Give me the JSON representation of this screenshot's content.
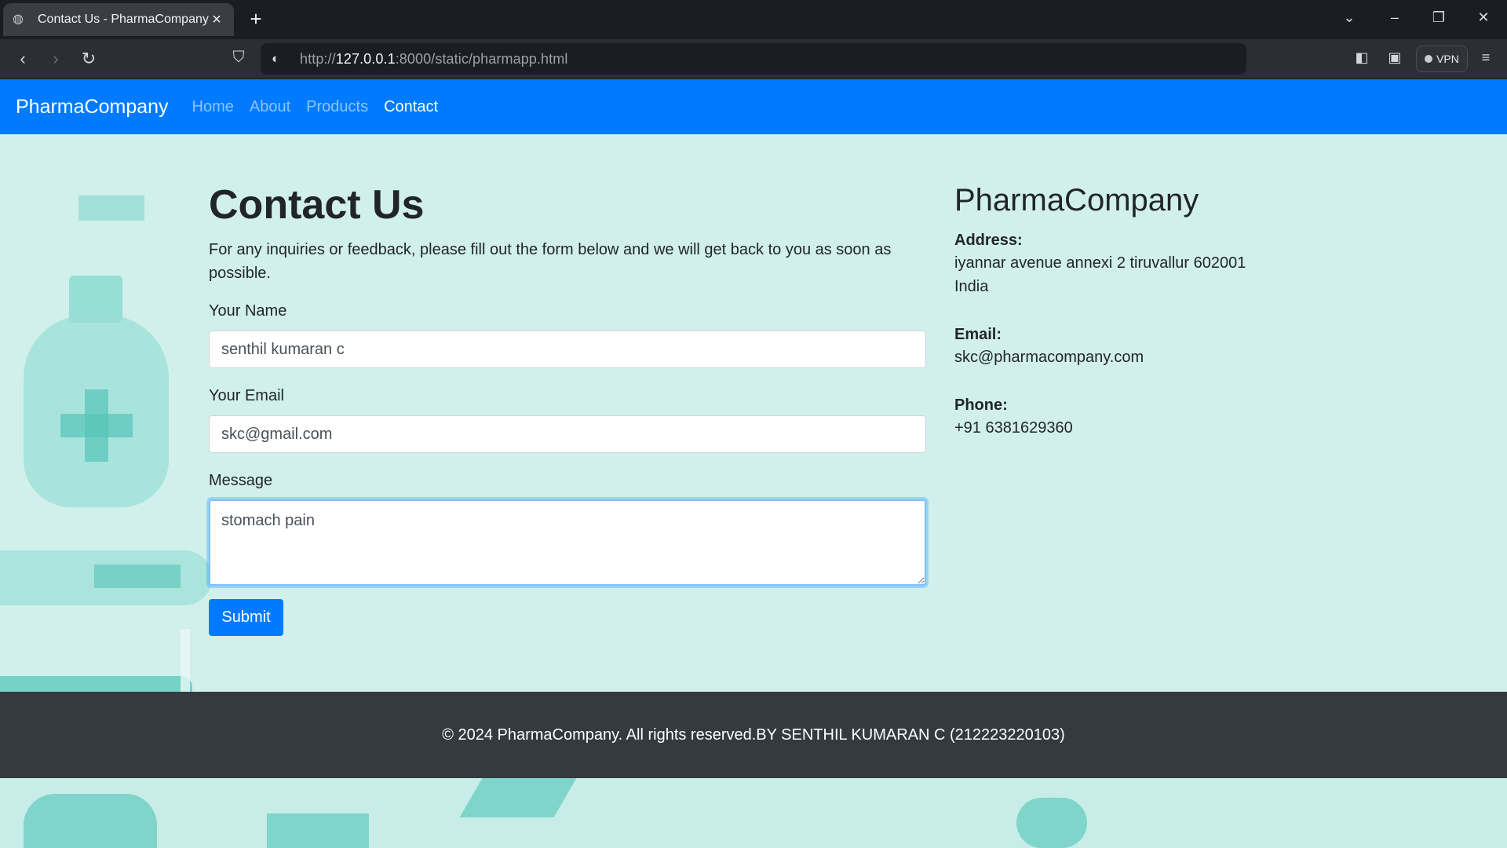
{
  "browser": {
    "tab_title": "Contact Us - PharmaCompany",
    "url_prefix": "http://",
    "url_host": "127.0.0.1",
    "url_rest": ":8000/static/pharmapp.html",
    "vpn_label": "VPN"
  },
  "nav": {
    "brand": "PharmaCompany",
    "links": [
      "Home",
      "About",
      "Products",
      "Contact"
    ],
    "active": "Contact"
  },
  "contact": {
    "title": "Contact Us",
    "intro": "For any inquiries or feedback, please fill out the form below and we will get back to you as soon as possible.",
    "name_label": "Your Name",
    "name_value": "senthil kumaran c",
    "email_label": "Your Email",
    "email_value": "skc@gmail.com",
    "message_label": "Message",
    "message_value": "stomach pain",
    "submit_label": "Submit"
  },
  "company": {
    "name": "PharmaCompany",
    "address_label": "Address:",
    "address_line1": "iyannar avenue annexi 2 tiruvallur 602001",
    "address_line2": "India",
    "email_label": "Email:",
    "email_value": "skc@pharmacompany.com",
    "phone_label": "Phone:",
    "phone_value": "+91 6381629360"
  },
  "footer": {
    "text": "© 2024 PharmaCompany. All rights reserved.BY SENTHIL KUMARAN C (212223220103)"
  },
  "colors": {
    "primary": "#007bff",
    "footer_bg": "#343a40",
    "page_bg": "#d1f0ec"
  }
}
